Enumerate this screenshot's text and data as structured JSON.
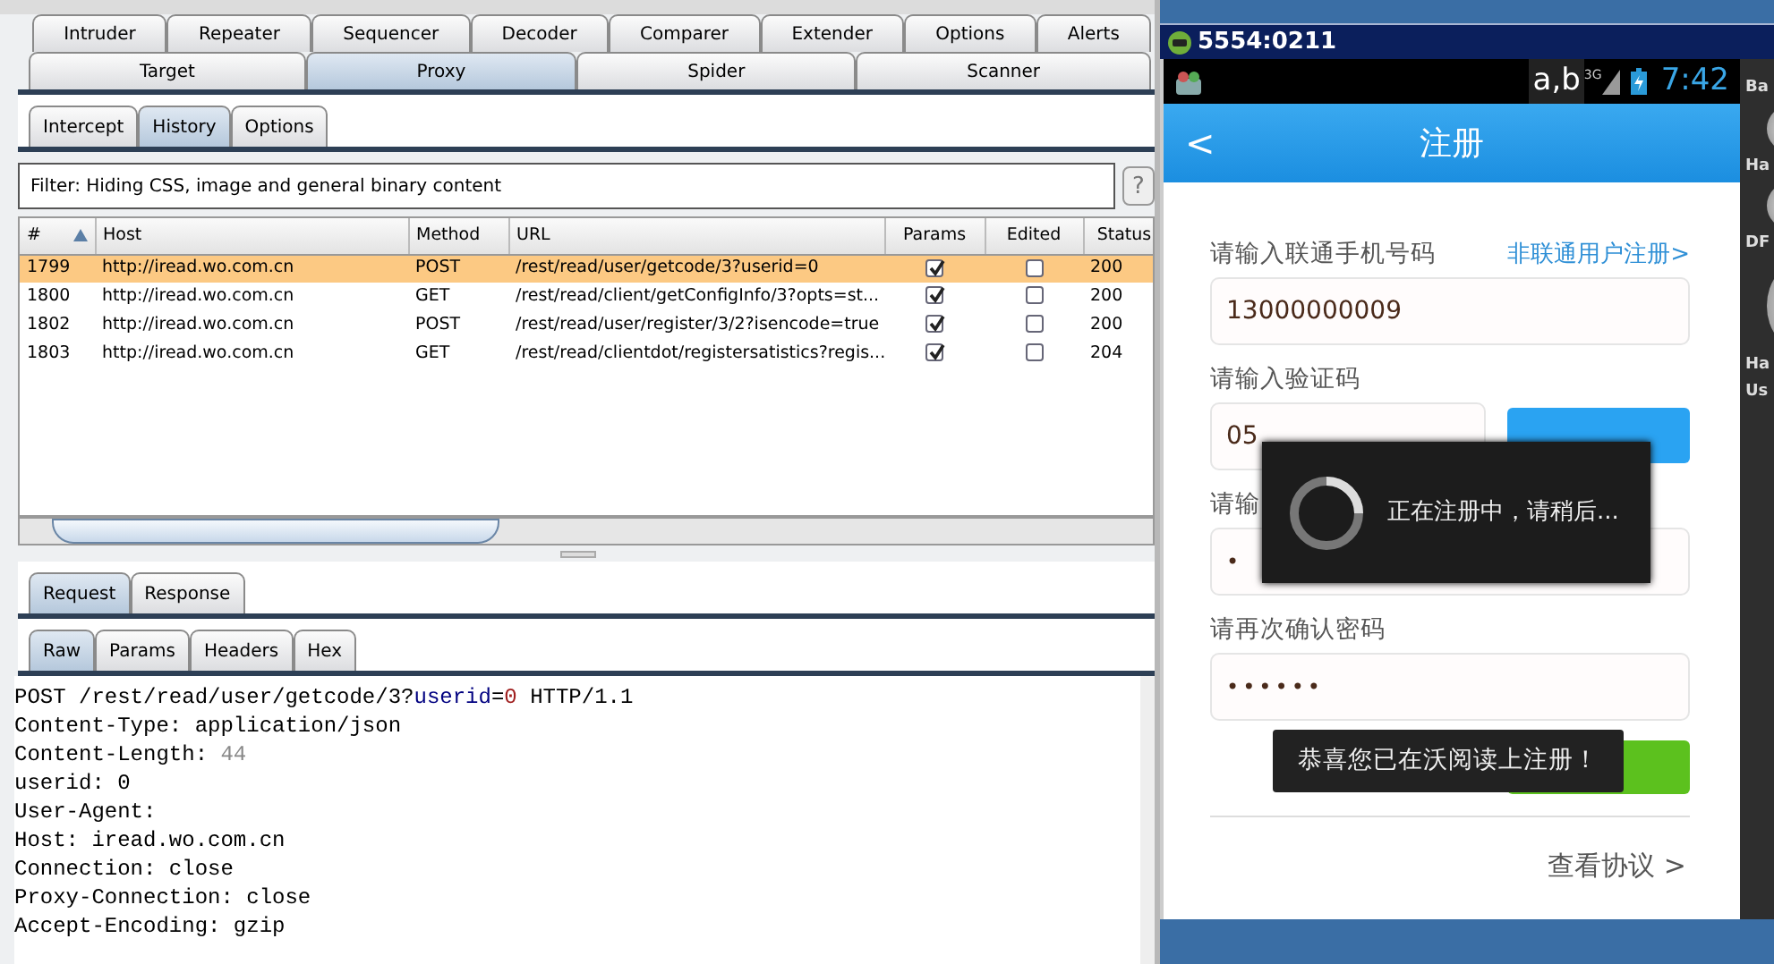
{
  "burp": {
    "main_tabs_row1": [
      {
        "label": "Intruder",
        "selected": false
      },
      {
        "label": "Repeater",
        "selected": false
      },
      {
        "label": "Sequencer",
        "selected": false
      },
      {
        "label": "Decoder",
        "selected": false
      },
      {
        "label": "Comparer",
        "selected": false
      },
      {
        "label": "Extender",
        "selected": false
      },
      {
        "label": "Options",
        "selected": false
      },
      {
        "label": "Alerts",
        "selected": false
      }
    ],
    "main_tabs_row2": [
      {
        "label": "Target",
        "selected": false
      },
      {
        "label": "Proxy",
        "selected": true
      },
      {
        "label": "Spider",
        "selected": false
      },
      {
        "label": "Scanner",
        "selected": false
      }
    ],
    "proxy_tabs": [
      {
        "label": "Intercept",
        "selected": false
      },
      {
        "label": "History",
        "selected": true
      },
      {
        "label": "Options",
        "selected": false
      }
    ],
    "filter": "Filter:  Hiding CSS, image and general binary content",
    "help_button": "?",
    "table": {
      "columns": [
        "#",
        "Host",
        "Method",
        "URL",
        "Params",
        "Edited",
        "Status"
      ],
      "rows": [
        {
          "number": "1799",
          "host": "http://iread.wo.com.cn",
          "method": "POST",
          "url": "/rest/read/user/getcode/3?userid=0",
          "params": true,
          "edited": false,
          "status": "200",
          "selected": true
        },
        {
          "number": "1800",
          "host": "http://iread.wo.com.cn",
          "method": "GET",
          "url": "/rest/read/client/getConfigInfo/3?opts=st...",
          "params": true,
          "edited": false,
          "status": "200",
          "selected": false
        },
        {
          "number": "1802",
          "host": "http://iread.wo.com.cn",
          "method": "POST",
          "url": "/rest/read/user/register/3/2?isencode=true",
          "params": true,
          "edited": false,
          "status": "200",
          "selected": false
        },
        {
          "number": "1803",
          "host": "http://iread.wo.com.cn",
          "method": "GET",
          "url": "/rest/read/clientdot/registersatistics?regis...",
          "params": true,
          "edited": false,
          "status": "204",
          "selected": false
        }
      ]
    },
    "message_tabs": [
      {
        "label": "Request",
        "selected": true
      },
      {
        "label": "Response",
        "selected": false
      }
    ],
    "view_tabs": [
      {
        "label": "Raw",
        "selected": true
      },
      {
        "label": "Params",
        "selected": false
      },
      {
        "label": "Headers",
        "selected": false
      },
      {
        "label": "Hex",
        "selected": false
      }
    ],
    "request_lines": [
      [
        {
          "text": "POST /rest/read/user/getcode/3?",
          "kind": "plain"
        },
        {
          "text": "userid",
          "kind": "param_name"
        },
        {
          "text": "=",
          "kind": "plain"
        },
        {
          "text": "0",
          "kind": "param_value"
        },
        {
          "text": " HTTP/1.1",
          "kind": "plain"
        }
      ],
      [
        {
          "text": "Content-Type: application/json",
          "kind": "plain"
        }
      ],
      [
        {
          "text": "Content-Length: ",
          "kind": "plain"
        },
        {
          "text": "44",
          "kind": "muted"
        }
      ],
      [
        {
          "text": "userid: 0",
          "kind": "plain"
        }
      ],
      [
        {
          "text": "User-Agent:",
          "kind": "plain"
        }
      ],
      [
        {
          "text": "Host: iread.wo.com.cn",
          "kind": "plain"
        }
      ],
      [
        {
          "text": "Connection: close",
          "kind": "plain"
        }
      ],
      [
        {
          "text": "Proxy-Connection: close",
          "kind": "plain"
        }
      ],
      [
        {
          "text": "Accept-Encoding: gzip",
          "kind": "plain"
        }
      ]
    ]
  },
  "emulator": {
    "title": "5554:0211",
    "status_bar": {
      "keyboard": "a,b",
      "network": "3G",
      "time": "7:42"
    },
    "header": {
      "back": "<",
      "title": "注册"
    },
    "fields": [
      {
        "kind": "text",
        "label": "请输入联通手机号码",
        "link": "非联通用户注册>",
        "value": "13000000009"
      },
      {
        "kind": "code",
        "label": "请输入验证码",
        "value": "05"
      },
      {
        "kind": "password",
        "label": "请输",
        "value": "•"
      },
      {
        "kind": "password",
        "label": "请再次确认密码",
        "value": "••••••"
      }
    ],
    "agreement_link": "查看协议 >",
    "progress_dialog": "正在注册中，请稍后...",
    "toast": "恭喜您已在沃阅读上注册！",
    "side_labels": [
      "Ba",
      "Ha",
      "DF",
      "Ha",
      "Us"
    ]
  }
}
